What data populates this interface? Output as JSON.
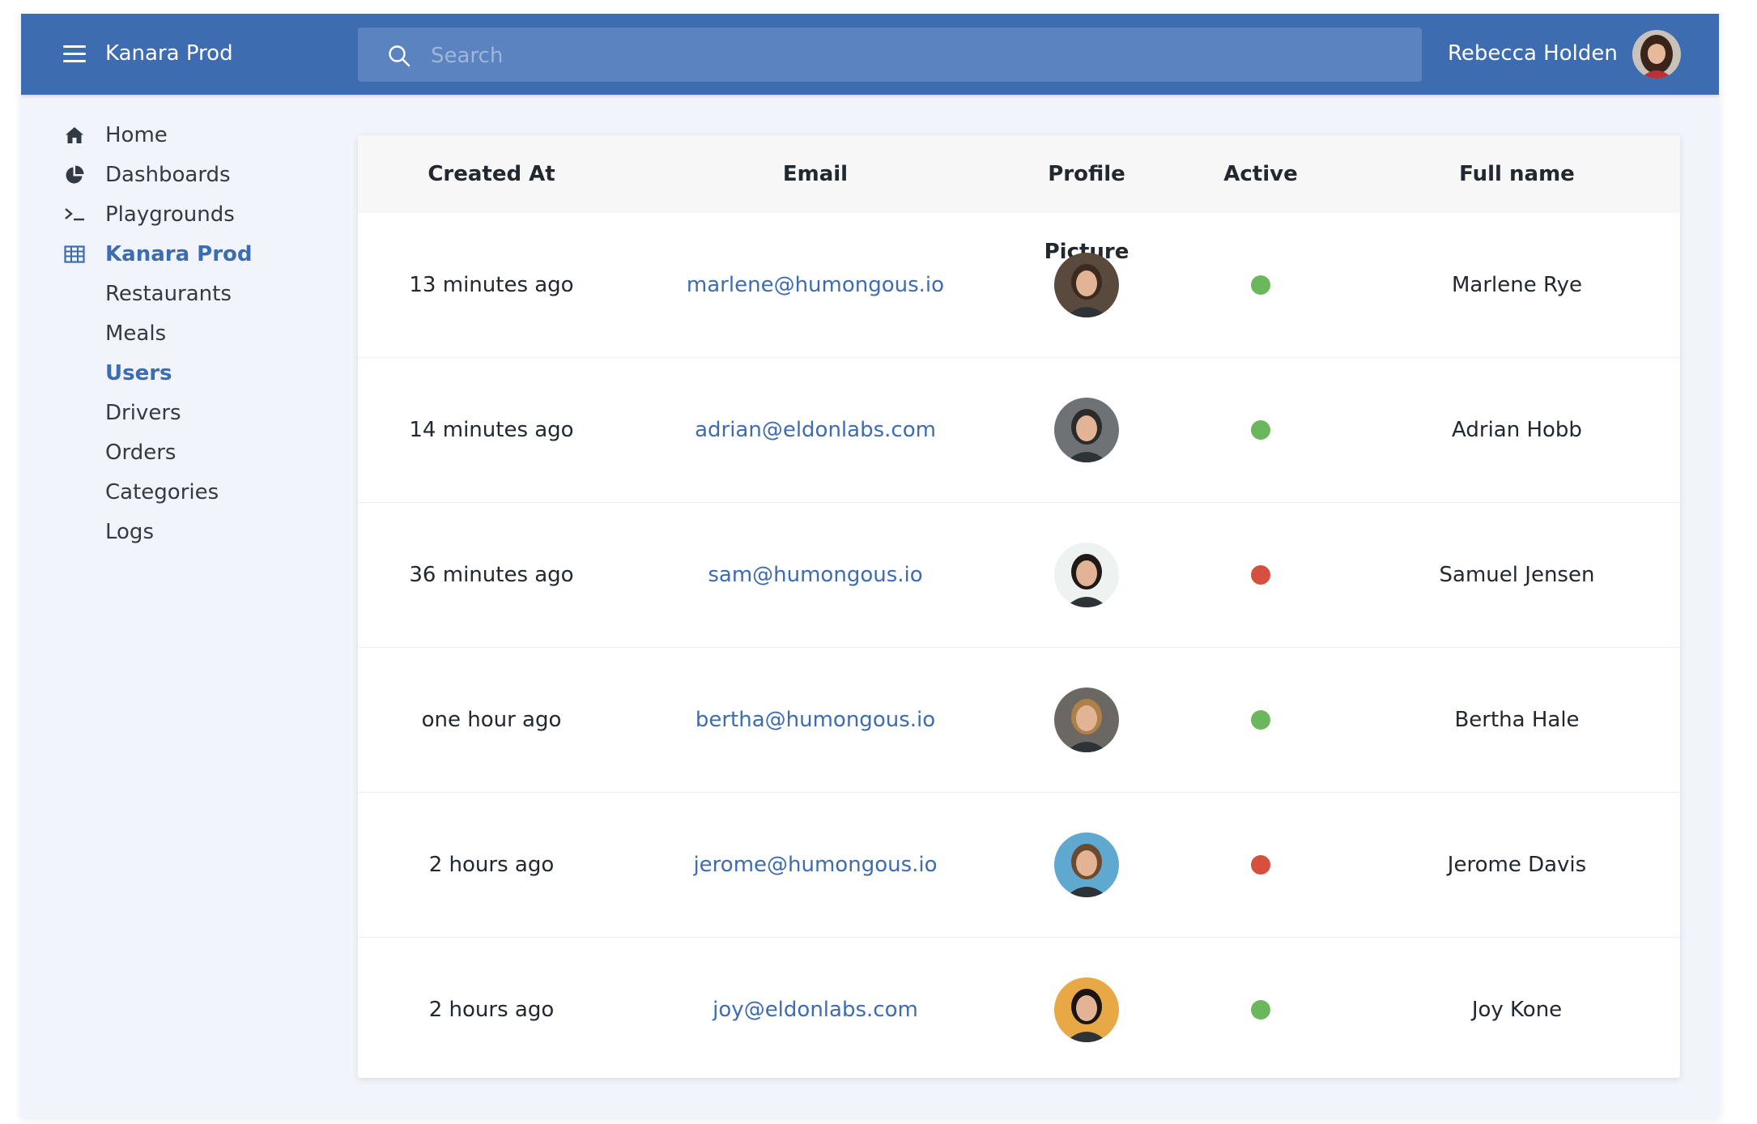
{
  "header": {
    "brand": "Kanara Prod",
    "search_placeholder": "Search",
    "user_name": "Rebecca Holden"
  },
  "sidebar": {
    "items": [
      {
        "label": "Home",
        "icon": "home-icon"
      },
      {
        "label": "Dashboards",
        "icon": "pie-chart-icon"
      },
      {
        "label": "Playgrounds",
        "icon": "terminal-icon"
      },
      {
        "label": "Kanara Prod",
        "icon": "table-icon",
        "active": true
      },
      {
        "label": "Restaurants"
      },
      {
        "label": "Meals"
      },
      {
        "label": "Users",
        "active": true
      },
      {
        "label": "Drivers"
      },
      {
        "label": "Orders"
      },
      {
        "label": "Categories"
      },
      {
        "label": "Logs"
      }
    ]
  },
  "table": {
    "columns": [
      "Created At",
      "Email",
      "Profile Picture",
      "Active",
      "Full name"
    ],
    "rows": [
      {
        "created_at": "13 minutes ago",
        "email": "marlene@humongous.io",
        "active": true,
        "full_name": "Marlene Rye",
        "avatar_bg": "#5a4a3e",
        "hair": "#3a2a20"
      },
      {
        "created_at": "14 minutes ago",
        "email": "adrian@eldonlabs.com",
        "active": true,
        "full_name": "Adrian Hobb",
        "avatar_bg": "#6f7275",
        "hair": "#2b2b2b"
      },
      {
        "created_at": "36 minutes ago",
        "email": "sam@humongous.io",
        "active": false,
        "full_name": "Samuel Jensen",
        "avatar_bg": "#eef2f0",
        "hair": "#1f1a17"
      },
      {
        "created_at": "one hour ago",
        "email": "bertha@humongous.io",
        "active": true,
        "full_name": "Bertha Hale",
        "avatar_bg": "#6b6763",
        "hair": "#b0804a"
      },
      {
        "created_at": "2 hours ago",
        "email": "jerome@humongous.io",
        "active": false,
        "full_name": "Jerome Davis",
        "avatar_bg": "#5fa8cf",
        "hair": "#6b4a30"
      },
      {
        "created_at": "2 hours ago",
        "email": "joy@eldonlabs.com",
        "active": true,
        "full_name": "Joy Kone",
        "avatar_bg": "#e8a845",
        "hair": "#1c1410"
      }
    ]
  },
  "colors": {
    "header": "#3d6cb0",
    "active_dot": "#6bb85c",
    "inactive_dot": "#d64f3f",
    "link": "#3d6cb0"
  }
}
